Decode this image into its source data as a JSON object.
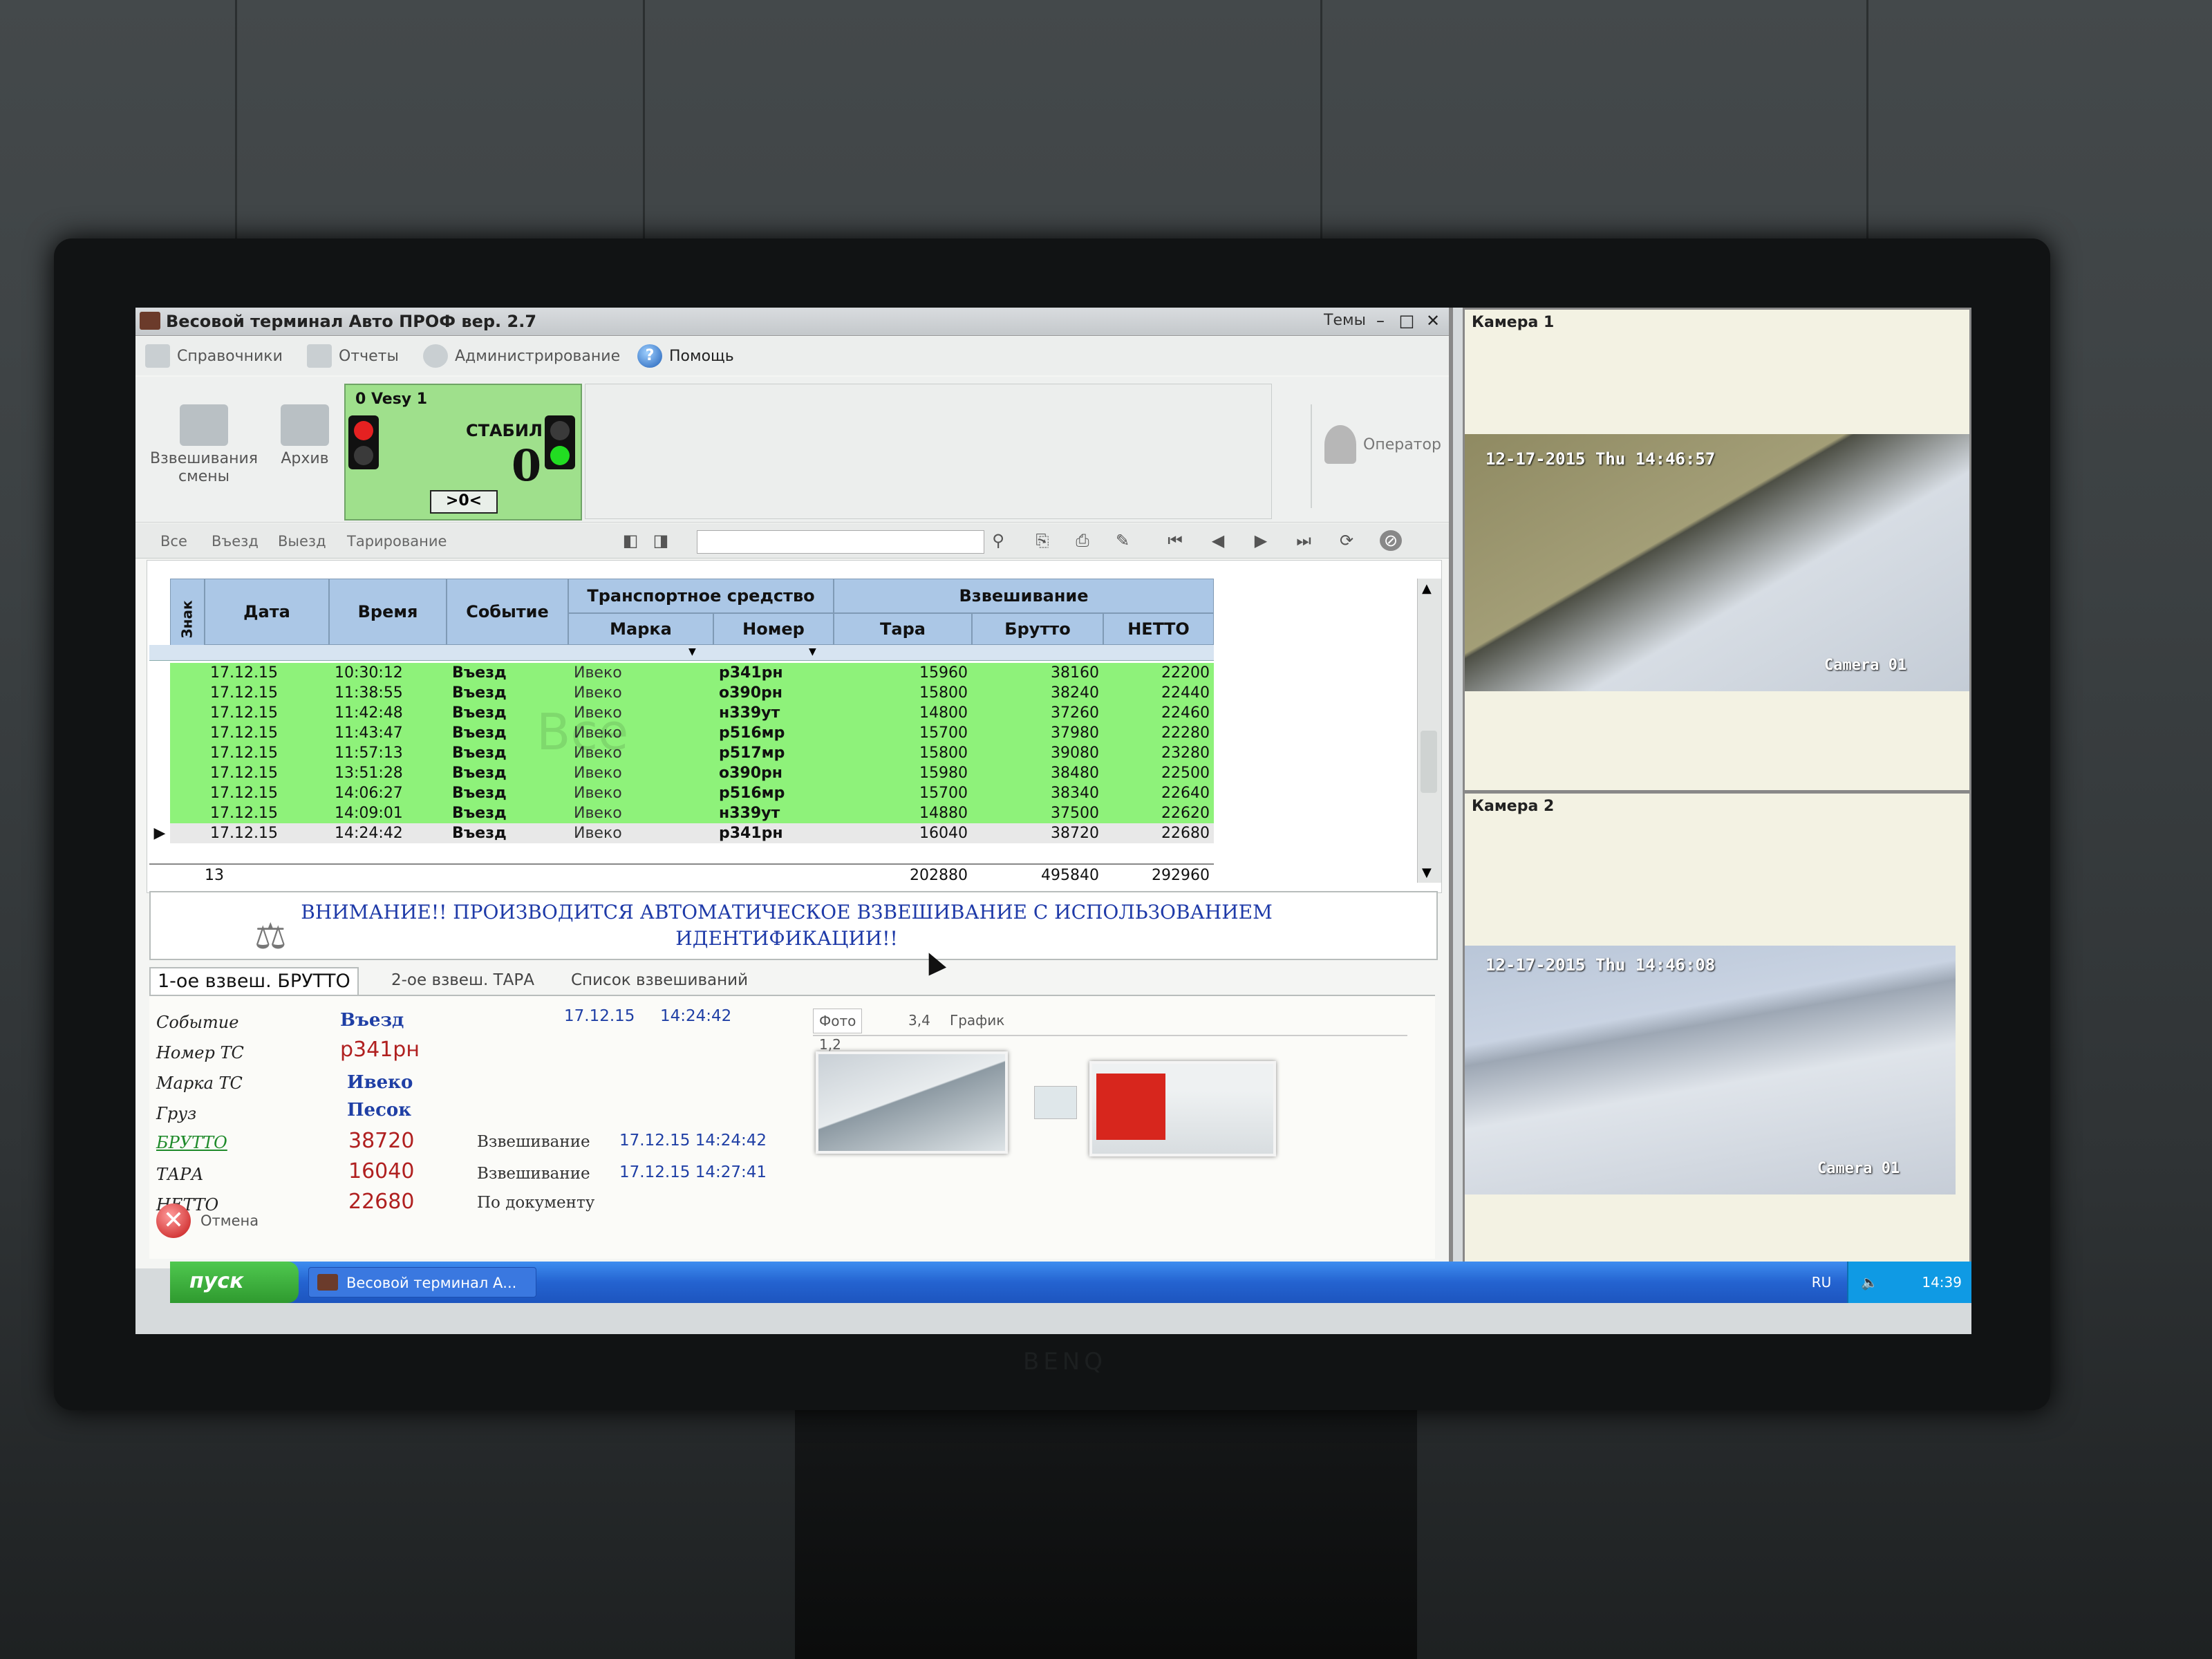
{
  "window": {
    "title": "Весовой терминал Авто ПРОФ вер. 2.7",
    "themes_label": "Темы",
    "minimize": "–",
    "maximize": "□",
    "close": "✕"
  },
  "menu": {
    "items": [
      {
        "label": "Справочники",
        "icon": "book-icon"
      },
      {
        "label": "Отчеты",
        "icon": "report-icon"
      },
      {
        "label": "Администрирование",
        "icon": "admin-icon"
      },
      {
        "label": "Помощь",
        "icon": "help-icon"
      }
    ]
  },
  "toolbar": {
    "shift_weighings": "Взвешивания смены",
    "archive": "Архив",
    "operator": "Оператор"
  },
  "scale": {
    "name": "0 Vesy 1",
    "status": "СТАБИЛ",
    "weight": "0",
    "zero_button": ">0<"
  },
  "filters": {
    "tabs": [
      "Все",
      "Въезд",
      "Выезд",
      "Тарирование"
    ],
    "search_value": ""
  },
  "grid": {
    "headers": {
      "sign": "Знак",
      "date": "Дата",
      "time": "Время",
      "event": "Событие",
      "vehicle_group": "Транспортное средство",
      "brand": "Марка",
      "number": "Номер",
      "weighing_group": "Взвешивание",
      "tare": "Тара",
      "gross": "Брутто",
      "net": "НЕТТО"
    },
    "rows": [
      {
        "date": "17.12.15",
        "time": "10:30:12",
        "event": "Въезд",
        "brand": "Ивеко",
        "number": "р341рн",
        "tare": "15960",
        "gross": "38160",
        "net": "22200",
        "state": "done"
      },
      {
        "date": "17.12.15",
        "time": "11:38:55",
        "event": "Въезд",
        "brand": "Ивеко",
        "number": "о390рн",
        "tare": "15800",
        "gross": "38240",
        "net": "22440",
        "state": "done"
      },
      {
        "date": "17.12.15",
        "time": "11:42:48",
        "event": "Въезд",
        "brand": "Ивеко",
        "number": "н339ут",
        "tare": "14800",
        "gross": "37260",
        "net": "22460",
        "state": "done"
      },
      {
        "date": "17.12.15",
        "time": "11:43:47",
        "event": "Въезд",
        "brand": "Ивеко",
        "number": "р516мр",
        "tare": "15700",
        "gross": "37980",
        "net": "22280",
        "state": "done"
      },
      {
        "date": "17.12.15",
        "time": "11:57:13",
        "event": "Въезд",
        "brand": "Ивеко",
        "number": "р517мр",
        "tare": "15800",
        "gross": "39080",
        "net": "23280",
        "state": "done"
      },
      {
        "date": "17.12.15",
        "time": "13:51:28",
        "event": "Въезд",
        "brand": "Ивеко",
        "number": "о390рн",
        "tare": "15980",
        "gross": "38480",
        "net": "22500",
        "state": "done"
      },
      {
        "date": "17.12.15",
        "time": "14:06:27",
        "event": "Въезд",
        "brand": "Ивеко",
        "number": "р516мр",
        "tare": "15700",
        "gross": "38340",
        "net": "22640",
        "state": "done"
      },
      {
        "date": "17.12.15",
        "time": "14:09:01",
        "event": "Въезд",
        "brand": "Ивеко",
        "number": "н339ут",
        "tare": "14880",
        "gross": "37500",
        "net": "22620",
        "state": "done"
      },
      {
        "date": "17.12.15",
        "time": "14:24:42",
        "event": "Въезд",
        "brand": "Ивеко",
        "number": "р341рн",
        "tare": "16040",
        "gross": "38720",
        "net": "22680",
        "state": "current"
      }
    ],
    "summary": {
      "count": "13",
      "tare": "202880",
      "gross": "495840",
      "net": "292960"
    },
    "watermark": "Все"
  },
  "banner": {
    "message": "ВНИМАНИЕ!! ПРОИЗВОДИТСЯ АВТОМАТИЧЕСКОЕ ВЗВЕШИВАНИЕ С ИСПОЛЬЗОВАНИЕМ ИДЕНТИФИКАЦИИ!!"
  },
  "lower_tabs": [
    "1-ое взвеш. БРУТТО",
    "2-ое взвеш. ТАРА",
    "Список взвешиваний"
  ],
  "details": {
    "event_label": "Событие",
    "event_value": "Въезд",
    "datetime": "17.12.15     14:24:42",
    "plate_label": "Номер ТС",
    "plate_value": "р341рн",
    "brand_label": "Марка ТС",
    "brand_value": "Ивеко",
    "cargo_label": "Груз",
    "cargo_value": "Песок",
    "gross_label": "БРУТТО",
    "gross_value": "38720",
    "gross_mode": "Взвешивание",
    "gross_time": "17.12.15 14:24:42",
    "tare_label": "ТАРА",
    "tare_value": "16040",
    "tare_mode": "Взвешивание",
    "tare_time": "17.12.15 14:27:41",
    "net_label": "НЕТТО",
    "net_value": "22680",
    "net_mode": "По документу"
  },
  "photo_tabs": [
    "Фото 1,2",
    "3,4",
    "График"
  ],
  "cancel_label": "Отмена",
  "cameras": [
    {
      "title": "Камера 1",
      "stamp": "12-17-2015 Thu 14:46:57",
      "label": "Camera 01"
    },
    {
      "title": "Камера 2",
      "stamp": "12-17-2015 Thu 14:46:08",
      "label": "Camera 01"
    }
  ],
  "taskbar": {
    "start": "пуск",
    "task": "Весовой терминал А...",
    "lang": "RU",
    "clock": "14:39"
  },
  "colors": {
    "row_done": "#8ef27a",
    "row_current": "#e8e8e8",
    "header": "#abc7e6",
    "scale_panel": "#9fe08c",
    "banner_text": "#1e3aa8"
  }
}
